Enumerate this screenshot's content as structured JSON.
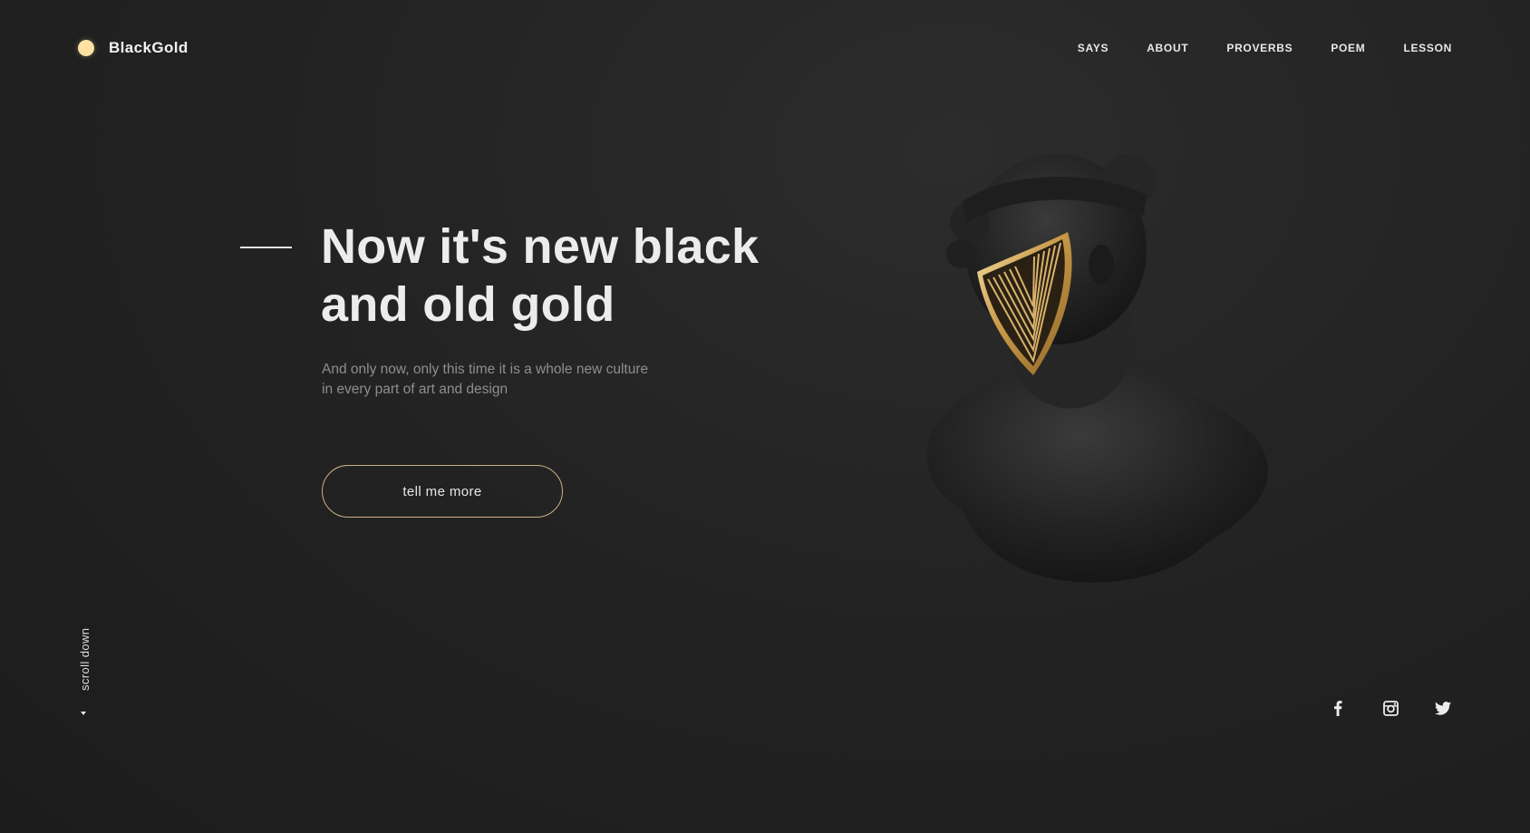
{
  "brand": {
    "name": "BlackGold",
    "dot_color": "#fde2a2"
  },
  "nav": {
    "items": [
      {
        "label": "SAYS"
      },
      {
        "label": "ABOUT"
      },
      {
        "label": "PROVERBS"
      },
      {
        "label": "POEM"
      },
      {
        "label": "LESSON"
      }
    ]
  },
  "hero": {
    "title_line1": "Now it's new black",
    "title_line2": "and old gold",
    "subtitle_line1": "And only now, only this time it is a whole new culture",
    "subtitle_line2": "in every part of art and design",
    "cta_label": "tell me more",
    "cta_border_color": "#cbb083"
  },
  "image": {
    "icon": "bust-with-gold-mask-icon"
  },
  "scroll": {
    "label": "scroll down"
  },
  "social": {
    "items": [
      {
        "icon": "facebook-icon"
      },
      {
        "icon": "instagram-icon"
      },
      {
        "icon": "twitter-icon"
      }
    ]
  },
  "colors": {
    "background": "#232323",
    "accent_gold": "#d8b46a"
  }
}
